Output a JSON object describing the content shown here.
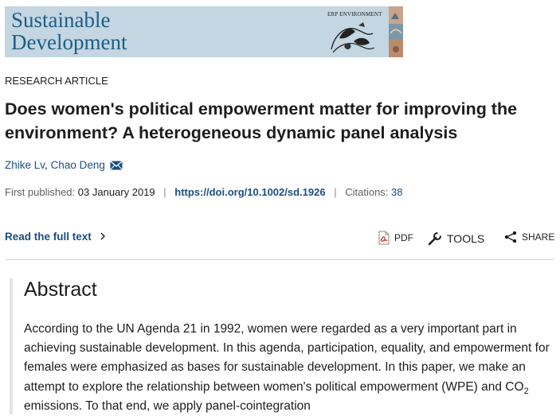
{
  "journal": {
    "name_line1": "Sustainable",
    "name_line2": "Development",
    "partner": "ERP ENVIRONMENT",
    "colors": {
      "banner_bg": "#c3d6e2",
      "title": "#1d5e86"
    }
  },
  "article": {
    "type": "RESEARCH ARTICLE",
    "title": "Does women's political empowerment matter for improving the environment? A heterogeneous dynamic panel analysis",
    "authors": [
      {
        "name": "Zhike Lv"
      },
      {
        "name": "Chao Deng",
        "icon": "mail-icon"
      }
    ],
    "author_separator": ",",
    "meta": {
      "published_label": "First published:",
      "published_date": "03 January 2019",
      "separator": "|",
      "doi": "https://doi.org/10.1002/sd.1926",
      "citations_label": "Citations:",
      "citations_count": "38"
    }
  },
  "actions": {
    "full_text": "Read the full text",
    "full_text_icon": "chevron-right-icon",
    "pdf": "PDF",
    "tools": "TOOLS",
    "share": "SHARE"
  },
  "abstract": {
    "heading": "Abstract",
    "text_part1": "According to the UN Agenda 21 in 1992, women were regarded as a very important part in achieving sustainable development. In this agenda, participation, equality, and empowerment for females were emphasized as bases for sustainable development. In this paper, we make an attempt to explore the relationship between women's political empowerment (WPE) and CO",
    "subscript": "2",
    "text_part2": " emissions. To that end, we apply panel-cointegration"
  },
  "colors": {
    "link": "#1a4f81",
    "text": "#1c1d1e",
    "muted": "#5f6060"
  }
}
